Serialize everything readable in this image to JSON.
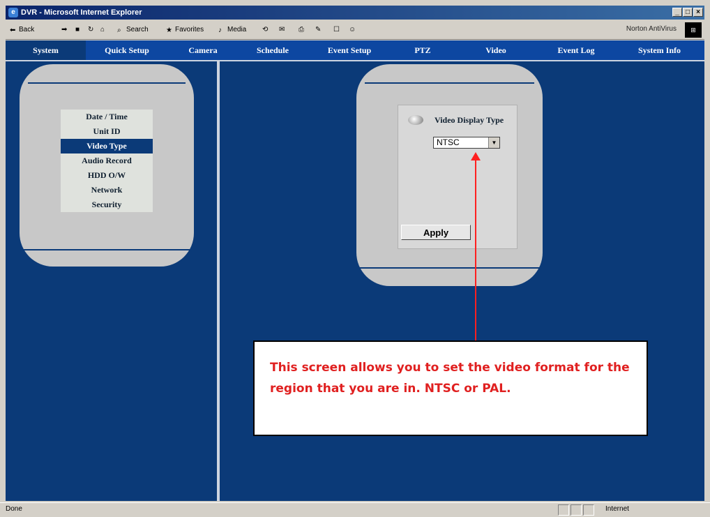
{
  "window": {
    "title": "DVR - Microsoft Internet Explorer",
    "controls": [
      "_",
      "□",
      "×"
    ]
  },
  "toolbar": {
    "items": [
      "Back",
      "Search",
      "Favorites",
      "Media"
    ],
    "norton": "Norton AntiVirus"
  },
  "nav": {
    "tabs": [
      "System",
      "Quick Setup",
      "Camera",
      "Schedule",
      "Event Setup",
      "PTZ",
      "Video",
      "Event Log",
      "System Info"
    ],
    "active": "System"
  },
  "sidebar": {
    "items": [
      "Date / Time",
      "Unit ID",
      "Video Type",
      "Audio Record",
      "HDD O/W",
      "Network",
      "Security"
    ],
    "selected": "Video Type"
  },
  "panel": {
    "title": "Video Display Type",
    "select_value": "NTSC",
    "apply_label": "Apply"
  },
  "callout": {
    "text": "This screen allows you to set the video format for the region that you are in. NTSC or PAL."
  },
  "status": {
    "left": "Done",
    "zone": "Internet"
  },
  "colors": {
    "nav": "#0b3a78",
    "callout_text": "#e02020",
    "arrow": "#ff2020"
  }
}
